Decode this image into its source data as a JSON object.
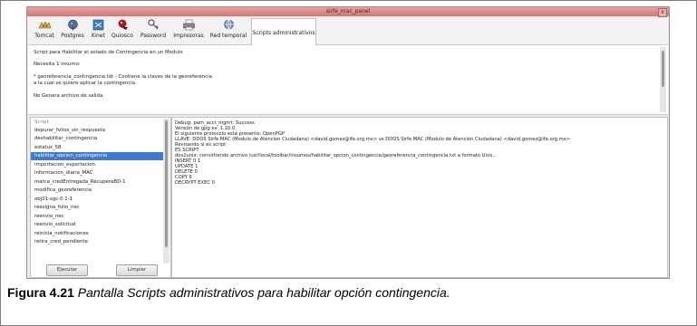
{
  "window": {
    "title": "sirfe_mac_panel",
    "close_glyph": "x"
  },
  "toolbar": {
    "tabs": [
      {
        "label": "Tomcat",
        "icon": "tomcat-icon"
      },
      {
        "label": "Postgres",
        "icon": "postgres-elephant-icon"
      },
      {
        "label": "Xinet",
        "icon": "xinet-icon"
      },
      {
        "label": "Quiosco",
        "icon": "kiosk-icon"
      },
      {
        "label": "Password",
        "icon": "key-icon"
      },
      {
        "label": "Impresoras",
        "icon": "printer-icon"
      },
      {
        "label": "Red temporal",
        "icon": "network-icon"
      },
      {
        "label": "Scripts administrativos",
        "icon": ""
      }
    ],
    "active_tab": "Scripts administrativos"
  },
  "description": {
    "lines": [
      "Script para Habilitar el estado de Contingencia en un Modulo",
      "Necesita 1 insumo:",
      "* georeferencia_contingencia.txt - Contiene la claves de la georeferencia",
      "  a la cual se quiere aplicar la contingencia.",
      "No Genera archivo de salida."
    ]
  },
  "script_list": {
    "header": "Script",
    "items": [
      "depurar_folios_sin_respuesta",
      "deshabilitar_contingencia",
      "estatus_58",
      "habilitar_opcion_contingencia",
      "importacion_exportacion",
      "informacion_diaria_MAC",
      "marca_credEntregada_RecuperaBD-1",
      "modifica_georeferencia",
      "obj01-sgc-0.1-1",
      "reasigna_folio_nec",
      "reenvio_nec",
      "reenvio_solicitud",
      "reinicia_notificaciones",
      "retira_cred_pendiente"
    ],
    "selected": "habilitar_opcion_contingencia"
  },
  "buttons": {
    "run": "Ejecutar",
    "clear": "Limpiar"
  },
  "output": {
    "lines": [
      "Debug: pam_acct_mgmt: Success",
      "Versión de gpg es: 1.10.0",
      "El siguiente protocolo está presente: OpenPGP",
      "LLAVE: DDOS Sirfe MAC (Modulo de Atencion Ciudadana) <david.gomez@ife.org.mx> vs DDOS Sirfe MAC (Modulo de Atencion Ciudadana) <david.gomez@ife.org.mx>",
      "Revisando si es script",
      "ES SCRIPT",
      "dos2unix: convirtiendo archivo /usr/local/toolbar/insumos/habilitar_opcion_contingencia/georeferencia_contingencia.txt a formato Unix...",
      "INSERT 0 1",
      "UPDATE 1",
      "DELETE 0",
      "COPY 6",
      "DECRYPT EXEC 0"
    ]
  },
  "caption": {
    "label": "Figura 4.21",
    "text": " Pantalla Scripts administrativos para habilitar opción contingencia."
  },
  "colors": {
    "titlebar": "#d47676",
    "selection": "#3d7ad3"
  }
}
